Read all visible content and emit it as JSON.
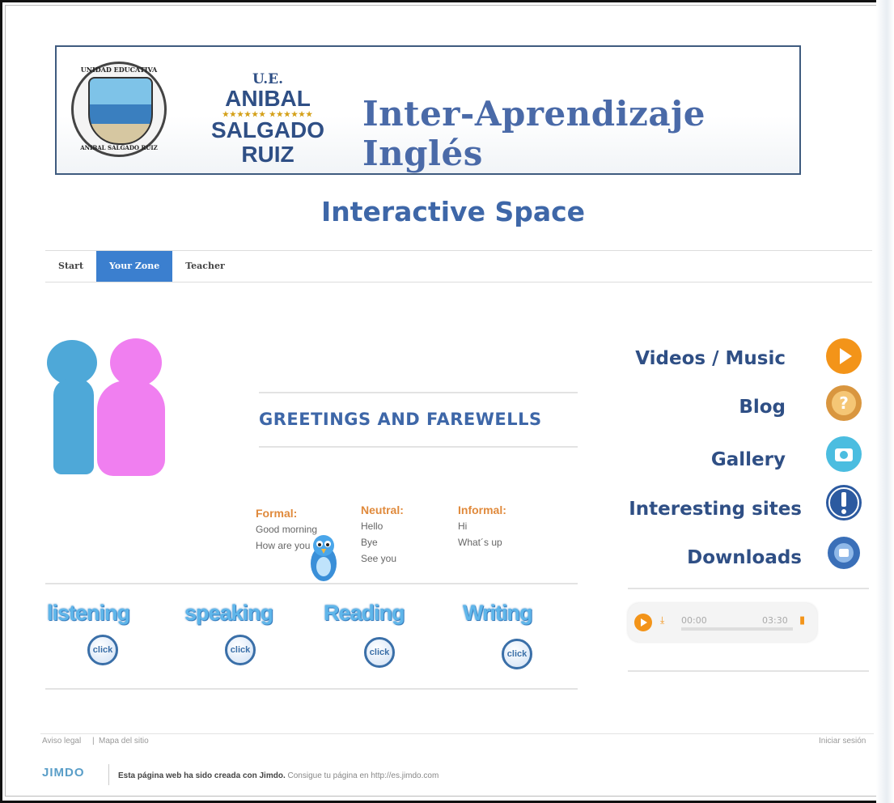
{
  "banner": {
    "school_ue": "U.E.",
    "school_line1": "ANIBAL",
    "school_stars": "★★★★★★ ★★★★★★",
    "school_line2": "SALGADO RUIZ",
    "title": "Inter-Aprendizaje Inglés",
    "seal_top": "UNIDAD EDUCATIVA",
    "seal_bottom": "ANIBAL SALGADO RUIZ"
  },
  "site_title": "Interactive Space",
  "nav": [
    {
      "label": "Start",
      "active": false
    },
    {
      "label": "Your Zone",
      "active": true
    },
    {
      "label": "Teacher",
      "active": false
    }
  ],
  "main": {
    "heading": "GREETINGS AND FAREWELLS",
    "columns": [
      {
        "header": "Formal:",
        "items": [
          "Good morning",
          "How are you"
        ]
      },
      {
        "header": "Neutral:",
        "items": [
          "Hello",
          "Bye",
          "See you"
        ]
      },
      {
        "header": "Informal:",
        "items": [
          "Hi",
          "What´s up"
        ]
      }
    ],
    "skills": [
      {
        "label": "listening",
        "button": "click"
      },
      {
        "label": "speaking",
        "button": "click"
      },
      {
        "label": "Reading",
        "button": "click"
      },
      {
        "label": "Writing",
        "button": "click"
      }
    ]
  },
  "sidebar": {
    "links": [
      {
        "label": "Videos / Music",
        "icon": "play-icon",
        "color": "#f39419"
      },
      {
        "label": "Blog",
        "icon": "question-icon",
        "color": "#d9963f"
      },
      {
        "label": "Gallery",
        "icon": "camera-icon",
        "color": "#4bbde0"
      },
      {
        "label": "Interesting  sites",
        "icon": "exclamation-icon",
        "color": "#2c5aa0"
      },
      {
        "label": "Downloads",
        "icon": "download-icon",
        "color": "#3a6fb8"
      }
    ],
    "player": {
      "current": "00:00",
      "duration": "03:30"
    }
  },
  "footer": {
    "legal": "Aviso legal",
    "separator": "|",
    "sitemap": "Mapa del sitio",
    "login": "Iniciar sesión",
    "brand": "JIMDO",
    "credit_bold": "Esta página web ha sido creada con Jimdo.",
    "credit_rest": " Consigue tu página en http://es.jimdo.com"
  }
}
